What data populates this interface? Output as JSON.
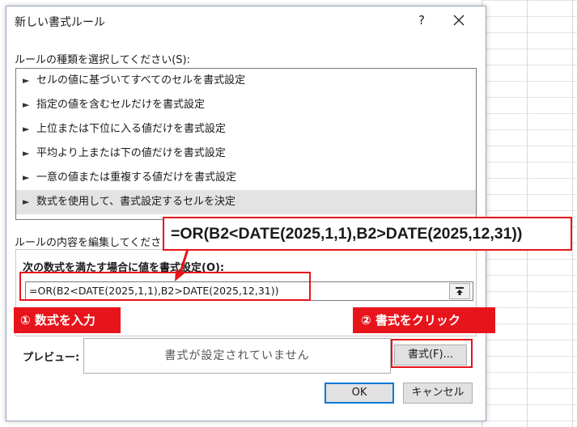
{
  "dialog": {
    "title": "新しい書式ルール",
    "help": "?",
    "close_icon": "close-icon"
  },
  "rule_type": {
    "label": "ルールの種類を選択してください(S):",
    "items": [
      {
        "label": "セルの値に基づいてすべてのセルを書式設定",
        "selected": false
      },
      {
        "label": "指定の値を含むセルだけを書式設定",
        "selected": false
      },
      {
        "label": "上位または下位に入る値だけを書式設定",
        "selected": false
      },
      {
        "label": "平均より上または下の値だけを書式設定",
        "selected": false
      },
      {
        "label": "一意の値または重複する値だけを書式設定",
        "selected": false
      },
      {
        "label": "数式を使用して、書式設定するセルを決定",
        "selected": true
      }
    ]
  },
  "edit": {
    "label": "ルールの内容を編集してください(E",
    "formula_label": "次の数式を満たす場合に値を書式設定(O):",
    "formula_value": "=OR(B2<DATE(2025,1,1),B2>DATE(2025,12,31))"
  },
  "preview": {
    "label": "プレビュー:",
    "text": "書式が設定されていません",
    "format_button": "書式(F)..."
  },
  "footer": {
    "ok": "OK",
    "cancel": "キャンセル"
  },
  "annotations": {
    "formula_banner": "=OR(B2<DATE(2025,1,1),B2>DATE(2025,12,31))",
    "step1": "① 数式を入力",
    "step2": "② 書式をクリック",
    "accent_color": "#e8141b"
  }
}
